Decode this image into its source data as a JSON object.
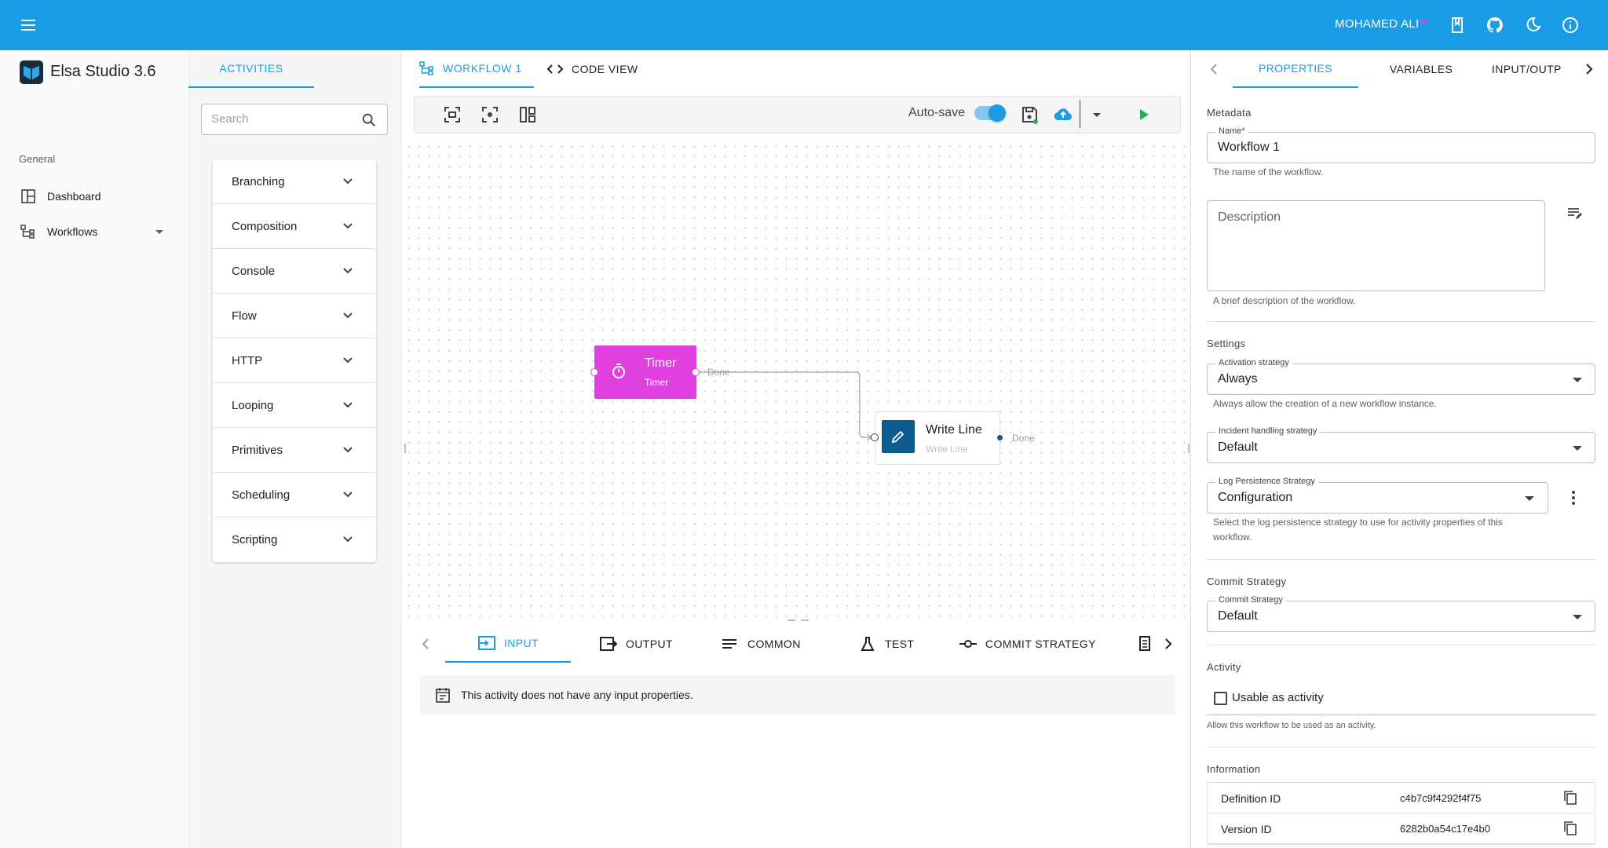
{
  "header": {
    "user": "MOHAMED ALI"
  },
  "brand": {
    "title": "Elsa Studio 3.6"
  },
  "nav": {
    "group": "General",
    "items": [
      {
        "label": "Dashboard"
      },
      {
        "label": "Workflows"
      }
    ]
  },
  "activities": {
    "tab": "ACTIVITIES",
    "search_placeholder": "Search",
    "categories": [
      "Branching",
      "Composition",
      "Console",
      "Flow",
      "HTTP",
      "Looping",
      "Primitives",
      "Scheduling",
      "Scripting"
    ]
  },
  "workflow": {
    "tabs": [
      "WORKFLOW 1",
      "CODE VIEW"
    ],
    "autosave_label": "Auto-save",
    "autosave_on": true,
    "nodes": {
      "timer": {
        "title": "Timer",
        "subtitle": "Timer",
        "port": "Done"
      },
      "writeline": {
        "title": "Write Line",
        "subtitle": "Write Line",
        "port": "Done"
      }
    }
  },
  "bottom": {
    "tabs": [
      "INPUT",
      "OUTPUT",
      "COMMON",
      "TEST",
      "COMMIT STRATEGY"
    ],
    "message": "This activity does not have any input properties."
  },
  "props": {
    "tabs": [
      "PROPERTIES",
      "VARIABLES",
      "INPUT/OUTP"
    ],
    "metadata": {
      "title": "Metadata",
      "name_label": "Name*",
      "name_value": "Workflow 1",
      "name_help": "The name of the workflow.",
      "desc_placeholder": "Description",
      "desc_help": "A brief description of the workflow."
    },
    "settings": {
      "title": "Settings",
      "activation_label": "Activation strategy",
      "activation_value": "Always",
      "activation_help": "Always allow the creation of a new workflow instance.",
      "incident_label": "Incident handling strategy",
      "incident_value": "Default",
      "log_label": "Log Persistence Strategy",
      "log_value": "Configuration",
      "log_help_1": "Select the log persistence strategy to use for activity properties of this",
      "log_help_2": "workflow."
    },
    "commit": {
      "title": "Commit Strategy",
      "label": "Commit Strategy",
      "value": "Default"
    },
    "activity": {
      "title": "Activity",
      "checkbox_label": "Usable as activity",
      "help": "Allow this workflow to be used as an activity."
    },
    "information": {
      "title": "Information",
      "rows": [
        {
          "key": "Definition ID",
          "value": "c4b7c9f4292f4f75"
        },
        {
          "key": "Version ID",
          "value": "6282b0a54c17e4b0"
        }
      ]
    }
  },
  "colors": {
    "primary": "#1a9be6",
    "timer": "#e040e0",
    "writeline": "#0d5a8f",
    "run": "#22b14c"
  }
}
